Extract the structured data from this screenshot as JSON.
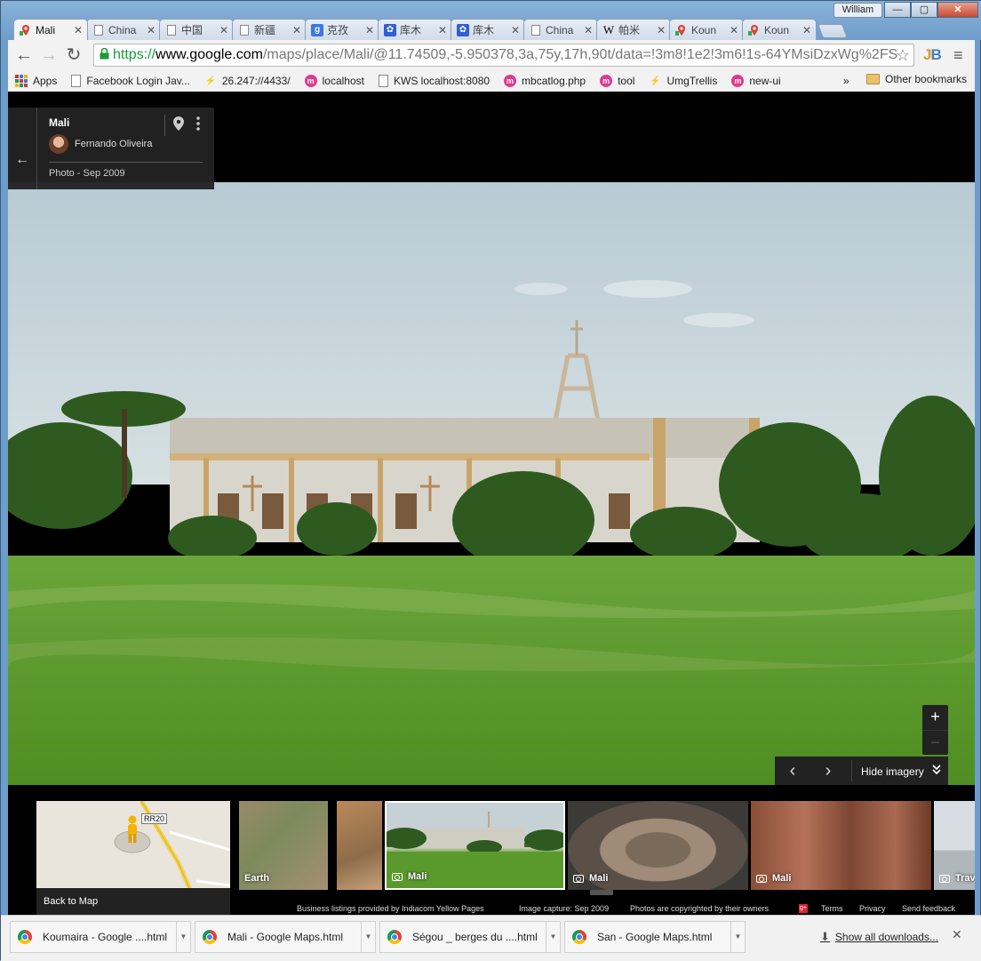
{
  "window": {
    "user": "William",
    "controls": [
      "—",
      "▢",
      "✕"
    ]
  },
  "tabs": [
    {
      "label": "Mali",
      "icon": "google-maps-icon",
      "active": true
    },
    {
      "label": "China",
      "icon": "page-icon"
    },
    {
      "label": "中国",
      "icon": "page-icon"
    },
    {
      "label": "新疆",
      "icon": "page-icon"
    },
    {
      "label": "克孜",
      "icon": "google-search-icon"
    },
    {
      "label": "库木",
      "icon": "baidu-icon"
    },
    {
      "label": "库木",
      "icon": "baidu-icon"
    },
    {
      "label": "China",
      "icon": "page-icon"
    },
    {
      "label": "帕米",
      "icon": "wikipedia-icon"
    },
    {
      "label": "Koun",
      "icon": "google-maps-icon"
    },
    {
      "label": "Koun",
      "icon": "google-maps-icon"
    }
  ],
  "toolbar": {
    "back": "←",
    "forward": "→",
    "reload": "↻",
    "url_scheme": "https://",
    "url_host": "www.google.com",
    "url_path": "/maps/place/Mali/@11.74509,-5.950378,3a,75y,17h,90t/data=!3m8!1e2!3m6!1s-64YMsiDzxWg%2FS",
    "star": "☆",
    "menu": "≡"
  },
  "bookmarks": [
    {
      "label": "Apps",
      "icon": "apps-grid-icon"
    },
    {
      "label": "Facebook Login Jav...",
      "icon": "page-icon"
    },
    {
      "label": "26.247://4433/",
      "icon": "stackblitz-icon"
    },
    {
      "label": "localhost",
      "icon": "m-icon"
    },
    {
      "label": "KWS localhost:8080",
      "icon": "page-icon"
    },
    {
      "label": "mbcatlog.php",
      "icon": "m-icon"
    },
    {
      "label": "tool",
      "icon": "m-icon"
    },
    {
      "label": "UmgTrellis",
      "icon": "stackblitz-icon"
    },
    {
      "label": "new-ui",
      "icon": "m-icon"
    }
  ],
  "bookmarks_more": "»",
  "bookmarks_other": "Other bookmarks",
  "infocard": {
    "back": "←",
    "title": "Mali",
    "author": "Fernando Oliveira",
    "date": "Photo - Sep 2009"
  },
  "zoom": {
    "in": "+",
    "out": "−"
  },
  "imagery": {
    "prev": "‹",
    "next": "›",
    "hide_label": "Hide imagery",
    "hide_icon": "chevron-double-down-icon"
  },
  "minimap": {
    "road_label": "RR20",
    "back_label": "Back to Map"
  },
  "thumbnails": [
    {
      "label": "Earth",
      "camera": false
    },
    {
      "label": "",
      "camera": false
    },
    {
      "label": "Mali",
      "camera": true,
      "selected": true
    },
    {
      "label": "Mali",
      "camera": true
    },
    {
      "label": "Mali",
      "camera": true
    },
    {
      "label": "Trav",
      "camera": true
    }
  ],
  "footer": {
    "listings": "Business listings provided by Indiacom Yellow Pages",
    "capture": "Image capture: Sep 2009",
    "copyright": "Photos are copyrighted by their owners",
    "gplus": "g+",
    "terms": "Terms",
    "privacy": "Privacy",
    "feedback": "Send feedback"
  },
  "downloads": [
    {
      "name": "Koumaira - Google ....html"
    },
    {
      "name": "Mali - Google Maps.html"
    },
    {
      "name": "Ségou _ berges du ....html"
    },
    {
      "name": "San - Google Maps.html"
    }
  ],
  "show_all_downloads": "Show all downloads...",
  "close_downloads": "✕"
}
